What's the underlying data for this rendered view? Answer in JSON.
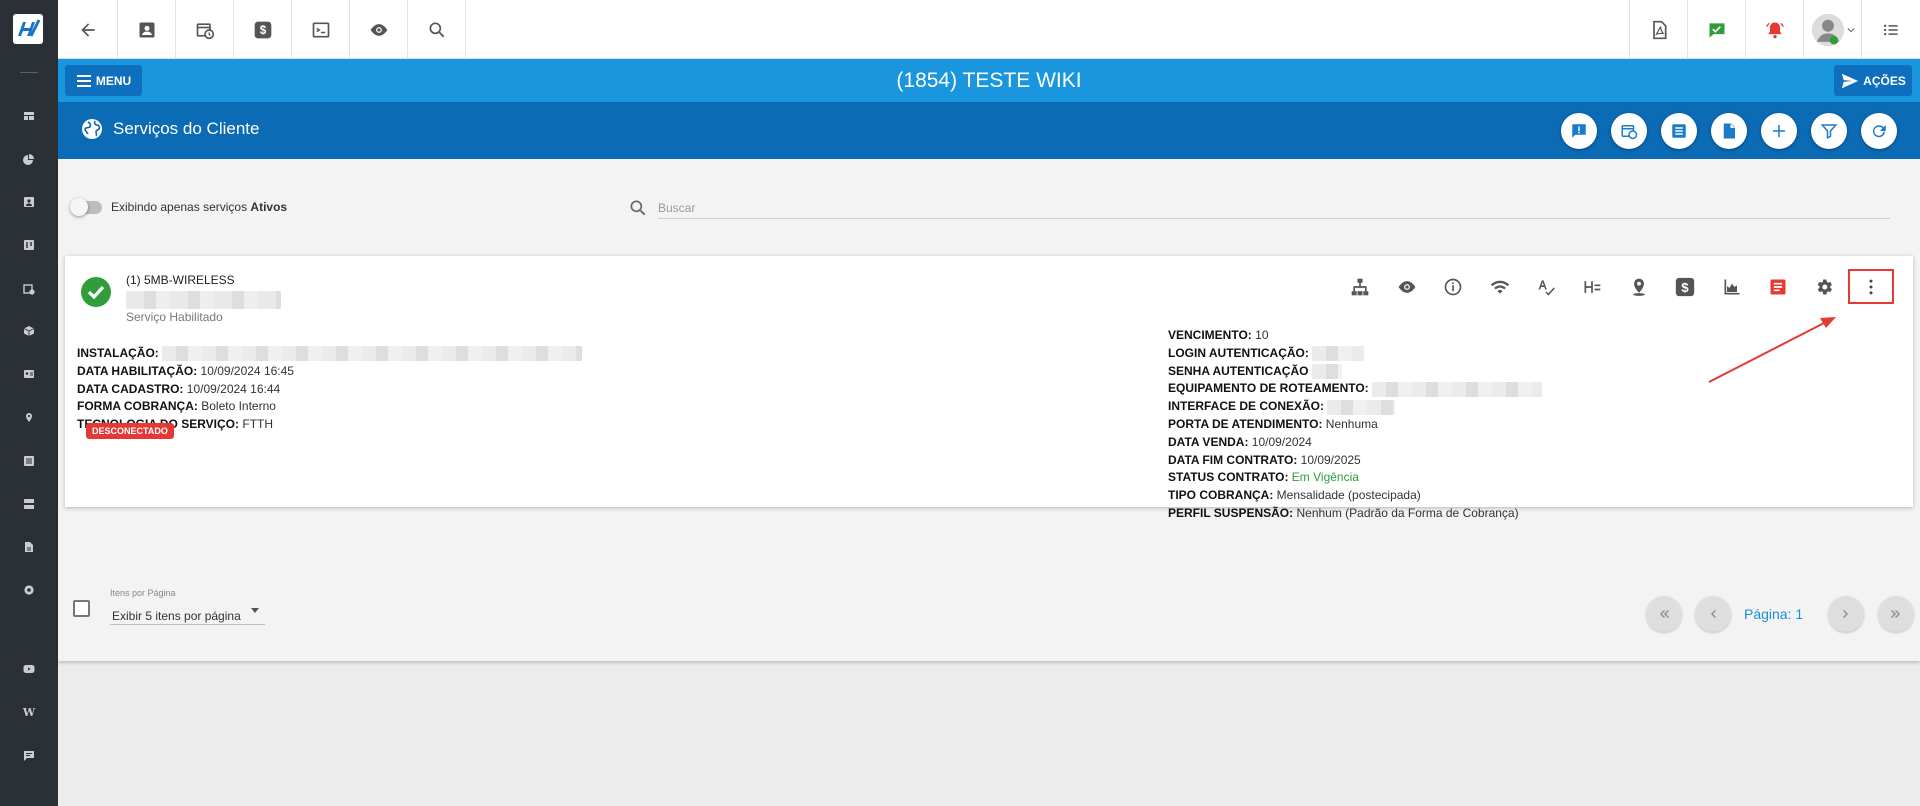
{
  "sidebar": {
    "icons": [
      "dashboard-icon",
      "pie-chart-icon",
      "contact-card-icon",
      "board-icon",
      "calendar-clock-icon",
      "package-icon",
      "id-card-icon",
      "location-pin-icon",
      "list-icon",
      "server-icon",
      "document-icon",
      "settings-icon",
      "youtube-icon",
      "wiki-icon",
      "chat-icon"
    ],
    "wiki_letter": "W"
  },
  "topbar": {
    "left_icons": [
      "back-arrow-icon",
      "contact-card-icon",
      "calendar-clock-icon",
      "dollar-icon",
      "terminal-icon",
      "eye-icon",
      "search-icon"
    ],
    "right_icons": [
      "pdf-document-icon",
      "green-check-icon",
      "alarm-bell-icon",
      "user-avatar",
      "hamburger-list-icon"
    ]
  },
  "header": {
    "menu_label": "MENU",
    "title": "(1854) TESTE WIKI",
    "actions_label": "AÇÕES"
  },
  "subheader": {
    "title": "Serviços do Cliente",
    "buttons": [
      "alert-comment-icon",
      "calendar-clock-icon",
      "list-icon",
      "document-icon",
      "add-icon",
      "filter-icon",
      "refresh-icon"
    ]
  },
  "filters": {
    "toggle_label": "Exibindo apenas serviços ",
    "toggle_label_bold": "Ativos",
    "search_placeholder": "Buscar"
  },
  "service": {
    "name": "(1) 5MB-WIRELESS",
    "status": "Serviço Habilitado",
    "badge": "DESCONECTADO",
    "action_icons": [
      "network-tree-icon",
      "eye-icon",
      "info-icon",
      "wifi-icon",
      "spellcheck-icon",
      "h-equals-icon",
      "location-pin-icon",
      "dollar-icon",
      "area-chart-icon",
      "contract-icon",
      "gear-icon",
      "more-vert-icon"
    ],
    "left_fields": [
      {
        "label": "INSTALAÇÃO:",
        "value": ""
      },
      {
        "label": "DATA HABILITAÇÃO:",
        "value": "10/09/2024 16:45"
      },
      {
        "label": "DATA CADASTRO:",
        "value": "10/09/2024 16:44"
      },
      {
        "label": "FORMA COBRANÇA:",
        "value": "Boleto Interno"
      },
      {
        "label": "TECNOLOGIA DO SERVIÇO:",
        "value": "FTTH"
      }
    ],
    "right_fields": [
      {
        "label": "VENCIMENTO:",
        "value": "10"
      },
      {
        "label": "LOGIN AUTENTICAÇÃO:",
        "value": ""
      },
      {
        "label": "SENHA AUTENTICAÇÃO",
        "value": ""
      },
      {
        "label": "EQUIPAMENTO DE ROTEAMENTO:",
        "value": ""
      },
      {
        "label": "INTERFACE DE CONEXÃO:",
        "value": ""
      },
      {
        "label": "PORTA DE ATENDIMENTO:",
        "value": "Nenhuma"
      },
      {
        "label": "DATA VENDA:",
        "value": "10/09/2024"
      },
      {
        "label": "DATA FIM CONTRATO:",
        "value": "10/09/2025"
      },
      {
        "label": "STATUS CONTRATO:",
        "value": "Em Vigência"
      },
      {
        "label": "TIPO COBRANÇA:",
        "value": "Mensalidade (postecipada)"
      },
      {
        "label": "PERFIL SUSPENSÃO:",
        "value": "Nenhum (Padrão da Forma de Cobrança)"
      }
    ]
  },
  "pagination": {
    "items_label": "Itens por Página",
    "items_value": "Exibir 5 itens por página",
    "page_label": "Página: 1"
  },
  "colors": {
    "sidebar": "#2b2f36",
    "header_blue": "#1a96df",
    "subheader_blue": "#0b6bb5",
    "success_green": "#2e9d3a",
    "danger_red": "#e53935"
  }
}
